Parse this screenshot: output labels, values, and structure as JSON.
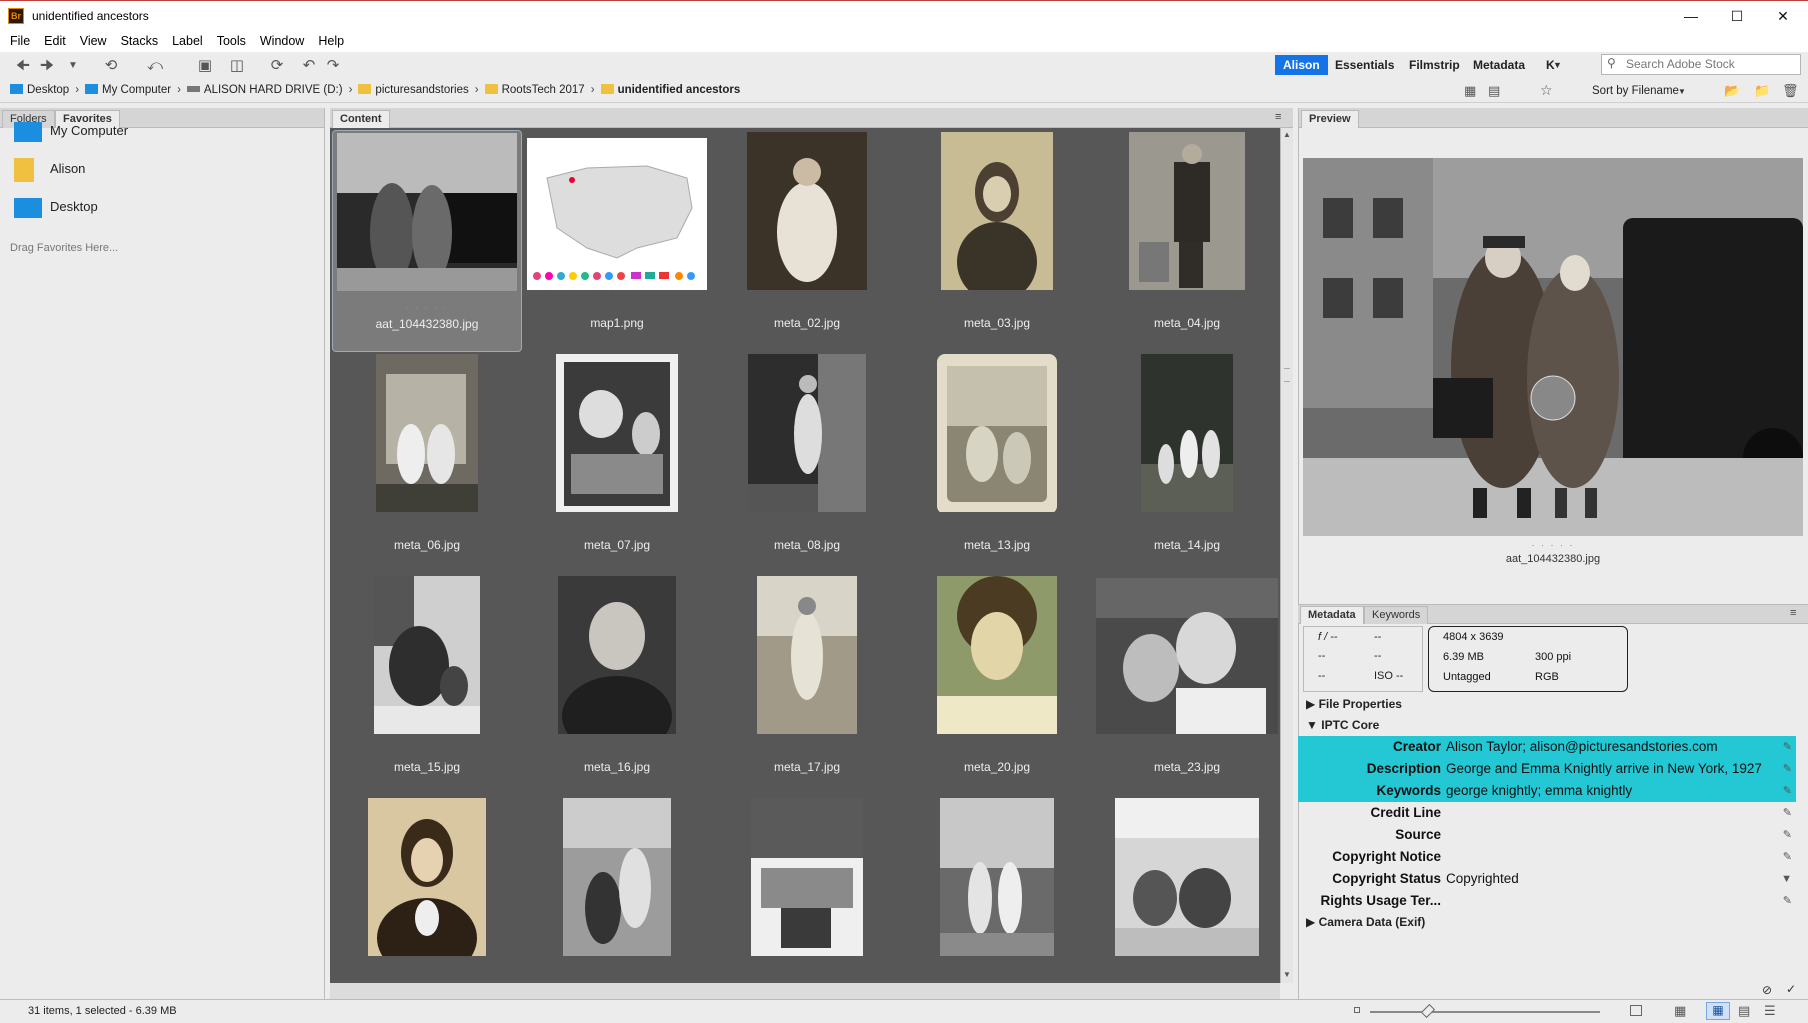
{
  "window": {
    "title": "unidentified ancestors",
    "app_icon": "Br"
  },
  "menu": [
    "File",
    "Edit",
    "View",
    "Stacks",
    "Label",
    "Tools",
    "Window",
    "Help"
  ],
  "workspaces": [
    "Alison",
    "Essentials",
    "Filmstrip",
    "Metadata",
    "K"
  ],
  "search": {
    "placeholder": "Search Adobe Stock"
  },
  "breadcrumb": [
    "Desktop",
    "My Computer",
    "ALISON HARD DRIVE (D:)",
    "picturesandstories",
    "RootsTech 2017",
    "unidentified ancestors"
  ],
  "sort": {
    "label": "Sort by Filename"
  },
  "left_panel": {
    "tabs": [
      "Folders",
      "Favorites"
    ],
    "favorites": [
      "My Computer",
      "Alison",
      "Desktop"
    ],
    "hint": "Drag Favorites Here..."
  },
  "content": {
    "tab": "Content",
    "items": [
      {
        "name": "aat_104432380.jpg",
        "selected": true
      },
      {
        "name": "map1.png"
      },
      {
        "name": "meta_02.jpg"
      },
      {
        "name": "meta_03.jpg"
      },
      {
        "name": "meta_04.jpg"
      },
      {
        "name": "meta_06.jpg"
      },
      {
        "name": "meta_07.jpg"
      },
      {
        "name": "meta_08.jpg"
      },
      {
        "name": "meta_13.jpg"
      },
      {
        "name": "meta_14.jpg"
      },
      {
        "name": "meta_15.jpg"
      },
      {
        "name": "meta_16.jpg"
      },
      {
        "name": "meta_17.jpg"
      },
      {
        "name": "meta_20.jpg"
      },
      {
        "name": "meta_23.jpg"
      }
    ]
  },
  "preview": {
    "tab": "Preview",
    "caption": "aat_104432380.jpg"
  },
  "metadata": {
    "tabs": [
      "Metadata",
      "Keywords"
    ],
    "camera": {
      "aperture": "f / --",
      "shutter": "--",
      "exposure": "--",
      "wb": "--",
      "ev": "--",
      "iso": "ISO --"
    },
    "info": {
      "dimensions": "4804 x 3639",
      "size": "6.39 MB",
      "resolution": "300 ppi",
      "tag": "Untagged",
      "mode": "RGB"
    },
    "sections": {
      "file_properties": "File Properties",
      "iptc": "IPTC Core",
      "camera_data": "Camera Data (Exif)"
    },
    "fields": [
      {
        "label": "Creator",
        "value": "Alison Taylor; alison@picturesandstories.com",
        "highlight": true
      },
      {
        "label": "Description",
        "value": "George and Emma Knightly arrive in New York, 1927",
        "highlight": true
      },
      {
        "label": "Keywords",
        "value": "george knightly; emma knightly",
        "highlight": true
      },
      {
        "label": "Credit Line",
        "value": ""
      },
      {
        "label": "Source",
        "value": ""
      },
      {
        "label": "Copyright Notice",
        "value": ""
      },
      {
        "label": "Copyright Status",
        "value": "Copyrighted"
      },
      {
        "label": "Rights Usage Ter...",
        "value": ""
      }
    ]
  },
  "status": "31 items, 1 selected - 6.39 MB",
  "colors": {
    "accent": "#1473e6",
    "highlight": "#23c8d4",
    "grid_bg": "#575757"
  }
}
